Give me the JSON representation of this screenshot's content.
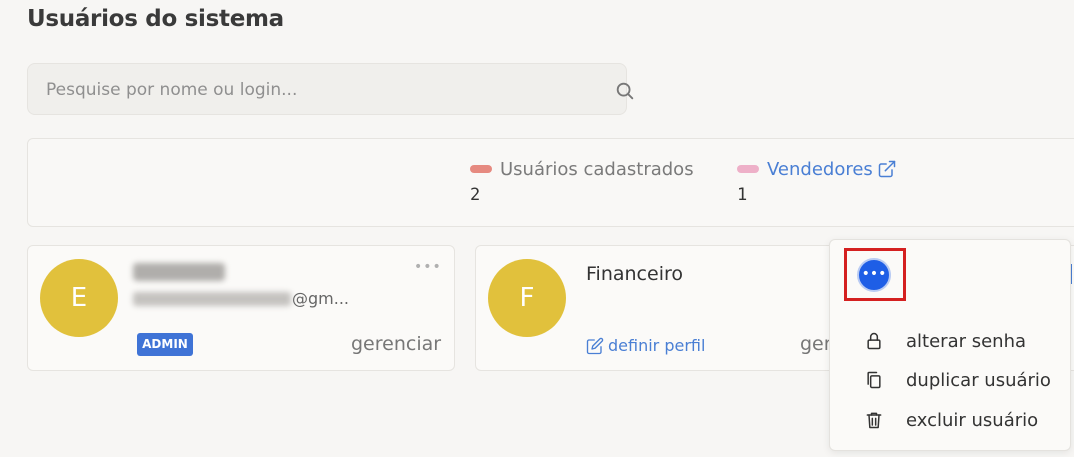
{
  "page": {
    "title": "Usuários do sistema"
  },
  "search": {
    "placeholder": "Pesquise por nome ou login...",
    "value": ""
  },
  "stats": [
    {
      "label": "Usuários cadastrados",
      "value": "2",
      "color": "#e68a80"
    },
    {
      "label": "Vendedores",
      "value": "1",
      "color": "#eeb0c8"
    }
  ],
  "users": [
    {
      "initial": "E",
      "email_suffix": "@gm...",
      "badge": "ADMIN",
      "action": "gerenciar"
    },
    {
      "initial": "F",
      "name": "Financeiro",
      "profile_action": "definir perfil",
      "action": "ger"
    }
  ],
  "menu": {
    "items": [
      {
        "label": "alterar senha",
        "icon": "lock-icon"
      },
      {
        "label": "duplicar usuário",
        "icon": "copy-icon"
      },
      {
        "label": "excluir usuário",
        "icon": "trash-icon"
      }
    ]
  },
  "colors": {
    "avatar": "#e1c13c",
    "accent": "#1e5ee6",
    "link": "#4a7fd4",
    "badge": "#3f73d6",
    "highlight": "#d42020"
  }
}
